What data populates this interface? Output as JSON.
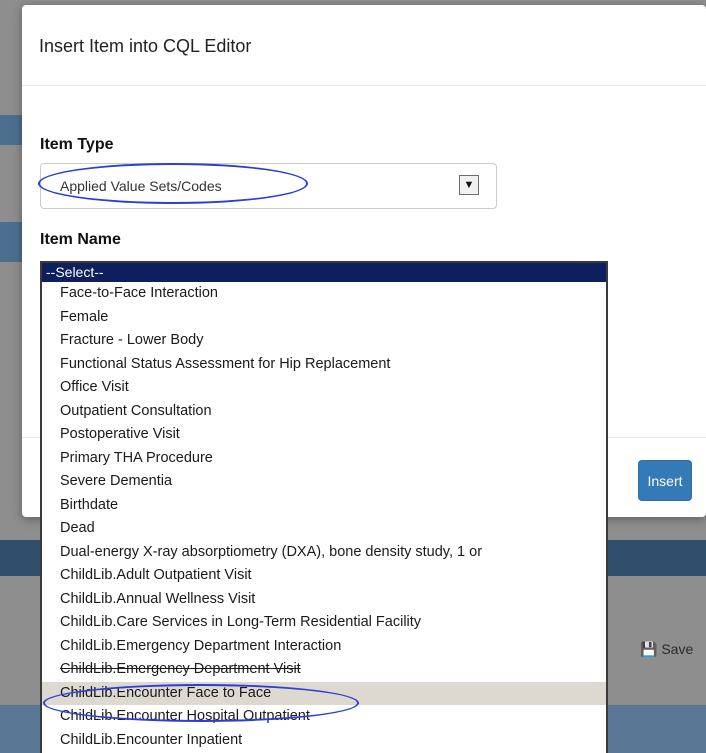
{
  "background": {
    "save_label": "Save"
  },
  "modal": {
    "title": "Insert Item into CQL Editor",
    "item_type_label": "Item Type",
    "item_type_value": "Applied Value Sets/Codes",
    "item_name_label": "Item Name",
    "insert_button": "Insert"
  },
  "dropdown": {
    "selected": "--Select--",
    "options": [
      "Face-to-Face Interaction",
      "Female",
      "Fracture - Lower Body",
      "Functional Status Assessment for Hip Replacement",
      "Office Visit",
      "Outpatient Consultation",
      "Postoperative Visit",
      "Primary THA Procedure",
      "Severe Dementia",
      "Birthdate",
      "Dead",
      "Dual-energy X-ray absorptiometry (DXA), bone density study, 1 or",
      "ChildLib.Adult Outpatient Visit",
      "ChildLib.Annual Wellness Visit",
      "ChildLib.Care Services in Long-Term Residential Facility",
      "ChildLib.Emergency Department Interaction",
      "ChildLib.Emergency Department Visit",
      "ChildLib.Encounter Face to Face",
      "ChildLib.Encounter Hospital Outpatient",
      "ChildLib.Encounter Inpatient"
    ],
    "hovered": "ChildLib.Encounter Face to Face"
  },
  "colors": {
    "annotation_circle": "#2a3fd6",
    "selected_row": "#0d1f5c",
    "insert_button": "#337ab7"
  }
}
